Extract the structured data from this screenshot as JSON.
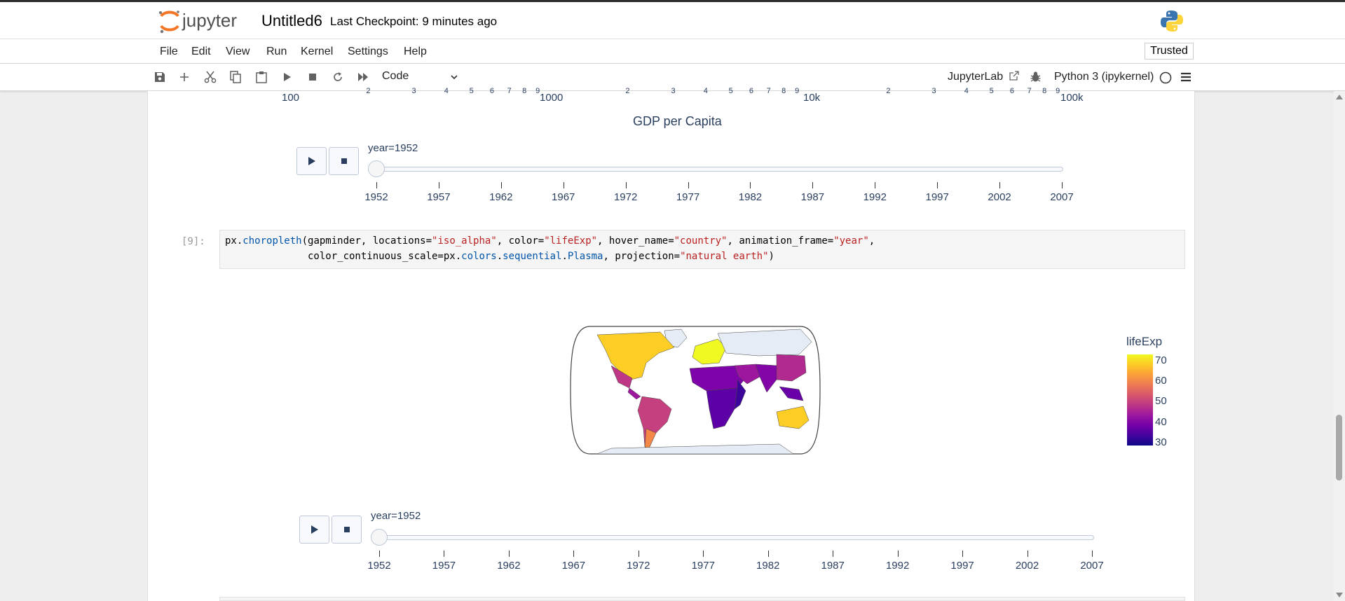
{
  "header": {
    "logo_text": "jupyter",
    "notebook_title": "Untitled6",
    "checkpoint": "Last Checkpoint: 9 minutes ago"
  },
  "menu": {
    "items": [
      "File",
      "Edit",
      "View",
      "Run",
      "Kernel",
      "Settings",
      "Help"
    ],
    "trusted": "Trusted"
  },
  "toolbar": {
    "icons": [
      "save-icon",
      "add-cell-icon",
      "cut-icon",
      "copy-icon",
      "paste-icon",
      "run-icon",
      "stop-icon",
      "restart-icon",
      "fast-forward-icon"
    ],
    "cell_type": "Code",
    "jupyterlab_label": "JupyterLab",
    "kernel_name": "Python 3 (ipykernel)"
  },
  "chart1": {
    "x_major_ticks": [
      "100",
      "1000",
      "10k",
      "100k"
    ],
    "x_minor_ticks": [
      "2",
      "3",
      "4",
      "5",
      "6",
      "7",
      "8",
      "9",
      "2",
      "3",
      "4",
      "5",
      "6",
      "7",
      "8",
      "9",
      "2",
      "3",
      "4",
      "5",
      "6",
      "7",
      "8",
      "9"
    ],
    "x_axis_title": "GDP per Capita",
    "slider_label": "year=1952"
  },
  "slider_years": [
    "1952",
    "1957",
    "1962",
    "1967",
    "1972",
    "1977",
    "1982",
    "1987",
    "1992",
    "1997",
    "2002",
    "2007"
  ],
  "cell9": {
    "prompt": "[9]:",
    "code_lines": [
      "px.choropleth(gapminder, locations=\"iso_alpha\", color=\"lifeExp\", hover_name=\"country\", animation_frame=\"year\",",
      "              color_continuous_scale=px.colors.sequential.Plasma, projection=\"natural earth\")"
    ]
  },
  "chart2": {
    "colorbar_title": "lifeExp",
    "colorbar_ticks": [
      "70",
      "60",
      "50",
      "40",
      "30"
    ],
    "slider_label": "year=1952"
  },
  "chart_data": {
    "type": "heatmap",
    "title": "",
    "colorbar": {
      "title": "lifeExp",
      "range": [
        28,
        72
      ],
      "ticks": [
        30,
        40,
        50,
        60,
        70
      ],
      "colorscale": "Plasma"
    },
    "projection": "natural earth",
    "animation_frame": "year",
    "current_frame": 1952,
    "frames": [
      1952,
      1957,
      1962,
      1967,
      1972,
      1977,
      1982,
      1987,
      1992,
      1997,
      2002,
      2007
    ]
  },
  "colors": {
    "plasma": [
      "#0d0887",
      "#46039f",
      "#7201a8",
      "#9c179e",
      "#bd3786",
      "#d8576b",
      "#ed7953",
      "#fb9f3a",
      "#fdca26",
      "#f0f921"
    ],
    "axis_text": "#2a3f5f",
    "code_string": "#ba2121",
    "code_attr": "#0055aa"
  }
}
